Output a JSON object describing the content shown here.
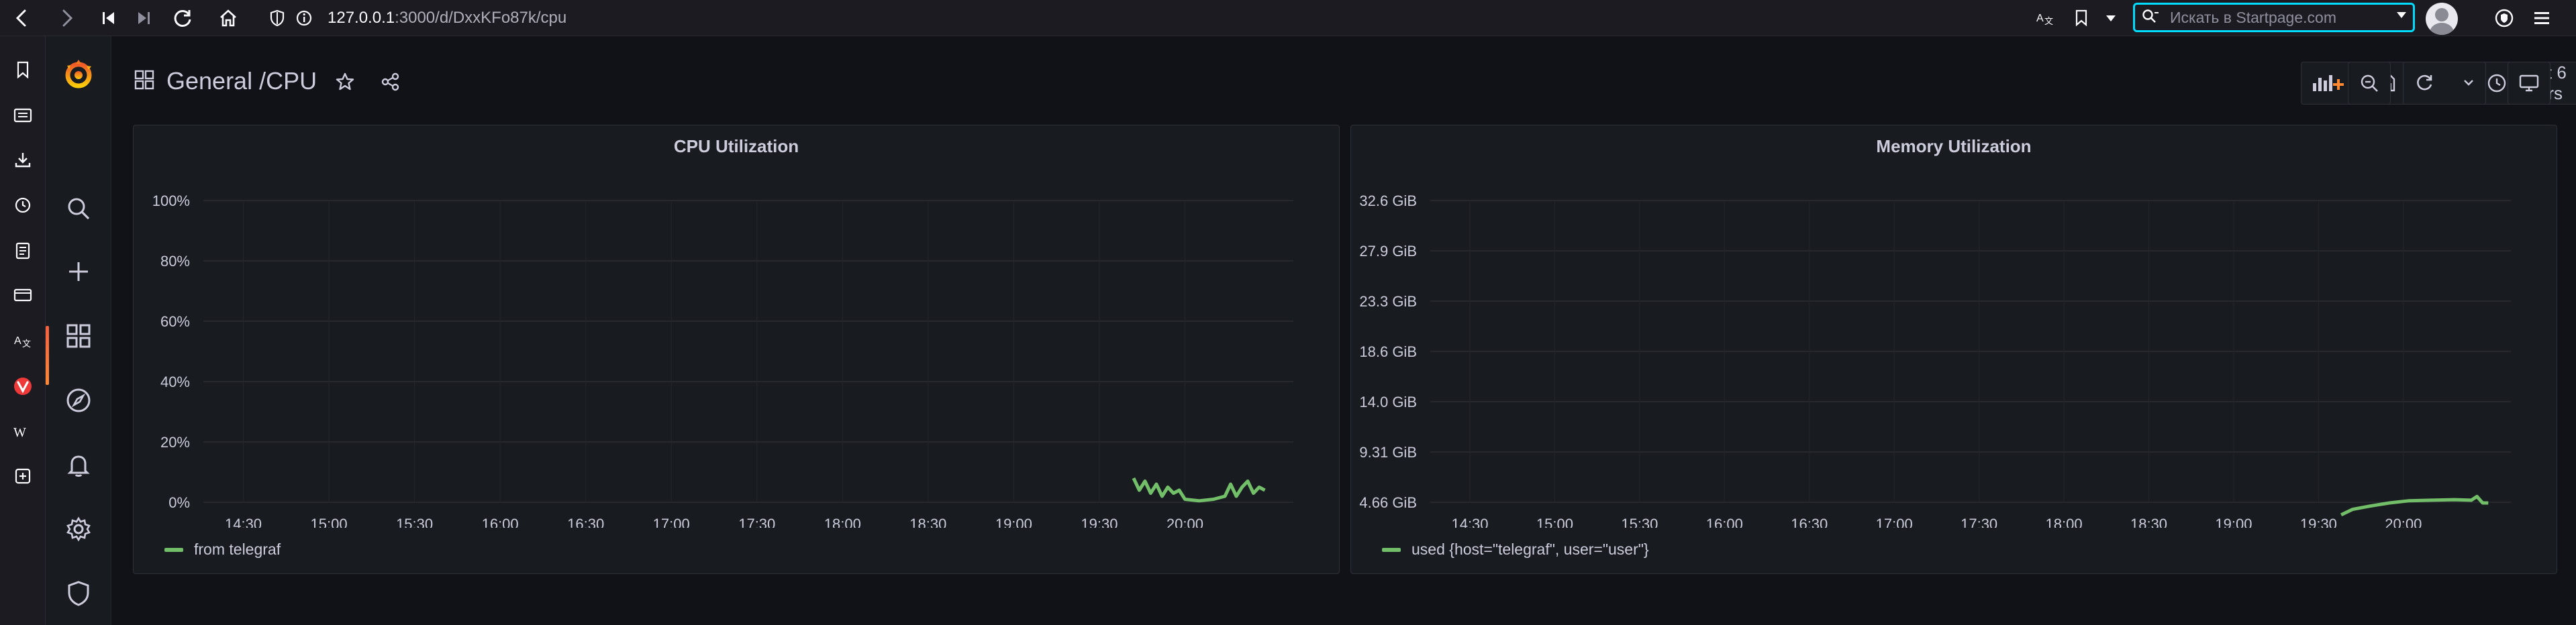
{
  "browser": {
    "url_host": "127.0.0.1",
    "url_path": ":3000/d/DxxKFo87k/cpu",
    "search_placeholder": "Искать в Startpage.com"
  },
  "dashboard": {
    "folder": "General",
    "separator": "/",
    "name": "CPU",
    "time_range_label": "Last 6 hours"
  },
  "panels": [
    {
      "title": "CPU Utilization",
      "legend": "from telegraf"
    },
    {
      "title": "Memory Utilization",
      "legend": "used {host=\"telegraf\", user=\"user\"}"
    }
  ],
  "chart_data": [
    {
      "type": "line",
      "title": "CPU Utilization",
      "x": [
        "14:30",
        "15:00",
        "15:30",
        "16:00",
        "16:30",
        "17:00",
        "17:30",
        "18:00",
        "18:30",
        "19:00",
        "19:30",
        "20:00"
      ],
      "yticks": [
        "0%",
        "20%",
        "40%",
        "60%",
        "80%",
        "100%"
      ],
      "ylim": [
        0,
        100
      ],
      "grid": true,
      "legend_placement": "bottom-left",
      "series": [
        {
          "name": "from telegraf",
          "color": "#73bf69",
          "points": [
            [
              "19:42",
              8
            ],
            [
              "19:44",
              4
            ],
            [
              "19:46",
              7
            ],
            [
              "19:48",
              3
            ],
            [
              "19:50",
              6
            ],
            [
              "19:52",
              2
            ],
            [
              "19:54",
              5
            ],
            [
              "19:56",
              3
            ],
            [
              "19:58",
              4
            ],
            [
              "20:00",
              1
            ],
            [
              "20:05",
              0.5
            ],
            [
              "20:10",
              1
            ],
            [
              "20:14",
              2
            ],
            [
              "20:16",
              6
            ],
            [
              "20:18",
              2
            ],
            [
              "20:20",
              5
            ],
            [
              "20:22",
              7
            ],
            [
              "20:24",
              3
            ],
            [
              "20:26",
              5
            ],
            [
              "20:28",
              4
            ]
          ]
        }
      ]
    },
    {
      "type": "line",
      "title": "Memory Utilization",
      "x": [
        "14:30",
        "15:00",
        "15:30",
        "16:00",
        "16:30",
        "17:00",
        "17:30",
        "18:00",
        "18:30",
        "19:00",
        "19:30",
        "20:00"
      ],
      "yticks": [
        "4.66 GiB",
        "9.31 GiB",
        "14.0 GiB",
        "18.6 GiB",
        "23.3 GiB",
        "27.9 GiB",
        "32.6 GiB"
      ],
      "ylim_gib": [
        1.5,
        32.6
      ],
      "grid": true,
      "legend_placement": "bottom-left",
      "series": [
        {
          "name": "used {host=\"telegraf\", user=\"user\"}",
          "color": "#73bf69",
          "points_gib": [
            [
              "19:38",
              3.5
            ],
            [
              "19:42",
              4.0
            ],
            [
              "19:48",
              4.3
            ],
            [
              "19:55",
              4.6
            ],
            [
              "20:02",
              4.8
            ],
            [
              "20:10",
              4.85
            ],
            [
              "20:18",
              4.9
            ],
            [
              "20:24",
              4.85
            ],
            [
              "20:26",
              5.2
            ],
            [
              "20:28",
              4.6
            ],
            [
              "20:30",
              4.6
            ]
          ]
        }
      ]
    }
  ]
}
